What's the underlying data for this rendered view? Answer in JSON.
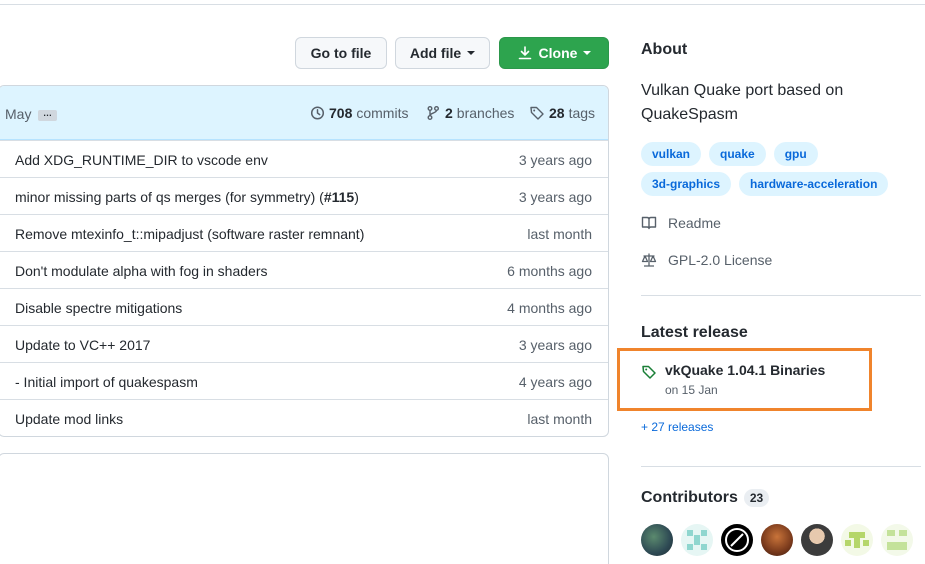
{
  "toolbar": {
    "go_to_file": "Go to file",
    "add_file": "Add file",
    "clone": "Clone"
  },
  "commit_header": {
    "month": "May",
    "ellipsis": "…",
    "commits_count": "708",
    "commits_label": "commits",
    "branches_count": "2",
    "branches_label": "branches",
    "tags_count": "28",
    "tags_label": "tags"
  },
  "files": [
    {
      "message": "Add XDG_RUNTIME_DIR to vscode env",
      "age": "3 years ago"
    },
    {
      "message": "minor missing parts of qs merges (for symmetry) (",
      "pr": "#115",
      "message_end": ")",
      "age": "3 years ago"
    },
    {
      "message": "Remove mtexinfo_t::mipadjust (software raster remnant)",
      "age": "last month"
    },
    {
      "message": "Don't modulate alpha with fog in shaders",
      "age": "6 months ago"
    },
    {
      "message": "Disable spectre mitigations",
      "age": "4 months ago"
    },
    {
      "message": "Update to VC++ 2017",
      "age": "3 years ago"
    },
    {
      "message": "- Initial import of quakespasm",
      "age": "4 years ago"
    },
    {
      "message": "Update mod links",
      "age": "last month"
    }
  ],
  "about": {
    "heading": "About",
    "description": "Vulkan Quake port based on QuakeSpasm",
    "topics": [
      "vulkan",
      "quake",
      "gpu",
      "3d-graphics",
      "hardware-acceleration"
    ],
    "readme": "Readme",
    "license": "GPL-2.0 License"
  },
  "latest_release": {
    "heading": "Latest release",
    "name": "vkQuake 1.04.1 Binaries",
    "date": "on 15 Jan",
    "more_releases": "+ 27 releases"
  },
  "contributors": {
    "heading": "Contributors",
    "count": "23"
  },
  "colors": {
    "accent_link": "#0969da",
    "clone_button": "#2da44e",
    "highlight_box": "#f0842c",
    "header_bg": "#ddf4ff"
  }
}
